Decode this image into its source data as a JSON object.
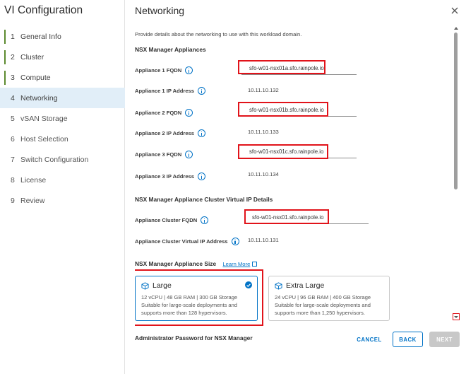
{
  "wizard": {
    "title": "VI Configuration",
    "steps": [
      {
        "num": "1",
        "label": "General Info"
      },
      {
        "num": "2",
        "label": "Cluster"
      },
      {
        "num": "3",
        "label": "Compute"
      },
      {
        "num": "4",
        "label": "Networking"
      },
      {
        "num": "5",
        "label": "vSAN Storage"
      },
      {
        "num": "6",
        "label": "Host Selection"
      },
      {
        "num": "7",
        "label": "Switch Configuration"
      },
      {
        "num": "8",
        "label": "License"
      },
      {
        "num": "9",
        "label": "Review"
      }
    ],
    "active_step": 4,
    "completed_color": "#5c8a2f"
  },
  "panel": {
    "title": "Networking",
    "close_icon": "close-icon",
    "intro": "Provide details about the networking to use with this workload domain.",
    "nsx_section": "NSX Manager Appliances",
    "fields": {
      "a1_fqdn_label": "Appliance 1 FQDN",
      "a1_fqdn_value": "sfo-w01-nsx01a.sfo.rainpole.io",
      "a1_ip_label": "Appliance 1 IP Address",
      "a1_ip_value": "10.11.10.132",
      "a2_fqdn_label": "Appliance 2 FQDN",
      "a2_fqdn_value": "sfo-w01-nsx01b.sfo.rainpole.io",
      "a2_ip_label": "Appliance 2 IP Address",
      "a2_ip_value": "10.11.10.133",
      "a3_fqdn_label": "Appliance 3 FQDN",
      "a3_fqdn_value": "sfo-w01-nsx01c.sfo.rainpole.io",
      "a3_ip_label": "Appliance 3 IP Address",
      "a3_ip_value": "10.11.10.134"
    },
    "vip_section": "NSX Manager Appliance Cluster Virtual IP Details",
    "vip": {
      "fqdn_label": "Appliance Cluster FQDN",
      "fqdn_value": "sfo-w01-nsx01.sfo.rainpole.io",
      "ip_label": "Appliance Cluster Virtual IP Address",
      "ip_value": "10.11.10.131"
    },
    "size_section": "NSX Manager Appliance Size",
    "learn_more": "Learn More",
    "sizes": {
      "large": {
        "title": "Large",
        "spec": "12 vCPU | 48 GB RAM | 300 GB Storage",
        "desc1": "Suitable for large-scale deployments and",
        "desc2": "supports more than 128 hypervisors.",
        "selected": true
      },
      "xlarge": {
        "title": "Extra Large",
        "spec": "24 vCPU | 96 GB RAM | 400 GB Storage",
        "desc1": "Suitable for large-scale deployments and",
        "desc2": "supports more than 1,250 hypervisors.",
        "selected": false
      }
    },
    "password_section": "Administrator Password for NSX Manager"
  },
  "footer": {
    "cancel": "CANCEL",
    "back": "BACK",
    "next": "NEXT"
  },
  "colors": {
    "accent": "#0072c6",
    "highlight_box": "#e1131a",
    "active_step_bg": "#e1eef8",
    "disabled_button": "#c8c8c8"
  }
}
